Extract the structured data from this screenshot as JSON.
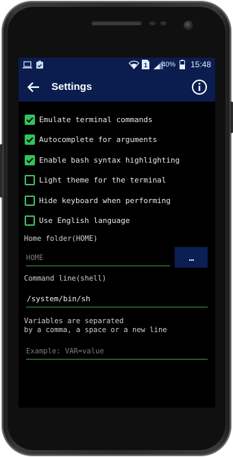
{
  "status_bar": {
    "battery_pct": "40%",
    "time": "15:48",
    "sim_badge": "1",
    "icons": [
      "laptop-icon",
      "clipboard-icon",
      "wifi-icon",
      "sim-icon",
      "signal-icon",
      "battery-icon"
    ]
  },
  "app_bar": {
    "title": "Settings",
    "back_icon": "arrow-left-icon",
    "info_icon": "info-icon",
    "color": "#0a1d4e"
  },
  "options": [
    {
      "label": "Emulate terminal commands",
      "checked": true
    },
    {
      "label": "Autocomplete for arguments",
      "checked": true
    },
    {
      "label": "Enable bash syntax highlighting",
      "checked": true
    },
    {
      "label": "Light theme for the terminal",
      "checked": false
    },
    {
      "label": "Hide keyboard when performing",
      "checked": false
    },
    {
      "label": "Use English language",
      "checked": false
    }
  ],
  "home_folder": {
    "label": "Home folder(HOME)",
    "placeholder": "HOME",
    "browse_label": "..."
  },
  "shell": {
    "label": "Command line(shell)",
    "value": "/system/bin/sh"
  },
  "variables": {
    "hint": "Variables are separated\nby a comma, a space or a new line",
    "placeholder": "Example: VAR=value"
  },
  "colors": {
    "accent": "#33c15a",
    "toolbar": "#0a1d4e",
    "background": "#000000"
  }
}
